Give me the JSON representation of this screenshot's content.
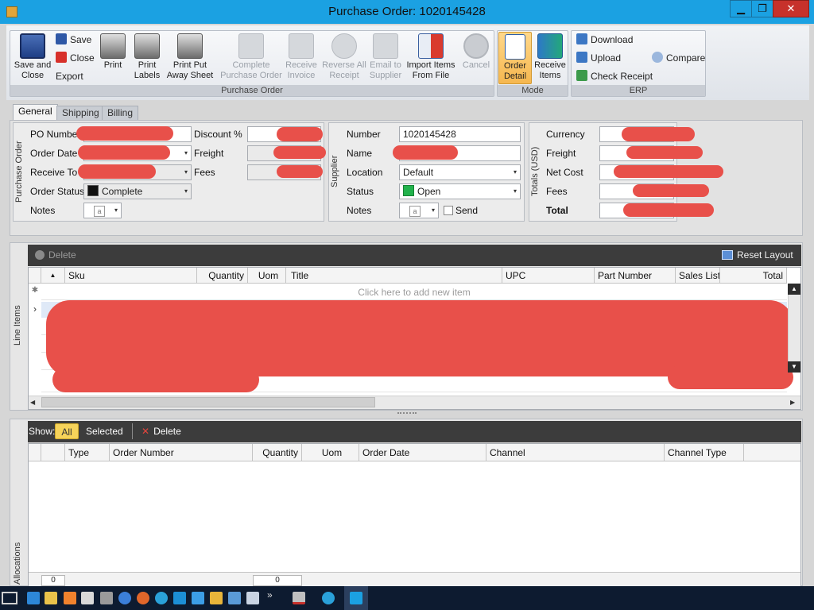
{
  "window": {
    "title": "Purchase Order: 1020145428",
    "min": "▁",
    "max": "❐",
    "close": "✕"
  },
  "ribbon": {
    "save_close": "Save and\nClose",
    "save": "Save",
    "close": "Close",
    "export": "Export",
    "print": "Print",
    "print_labels": "Print\nLabels",
    "print_put_away": "Print Put\nAway Sheet",
    "complete_po": "Complete\nPurchase Order",
    "receive_invoice": "Receive\nInvoice",
    "reverse_all": "Reverse All\nReceipt",
    "email_supplier": "Email to\nSupplier",
    "import_items": "Import Items\nFrom File",
    "cancel": "Cancel",
    "group_po": "Purchase Order",
    "order_detail": "Order\nDetail",
    "receive_items": "Receive\nItems",
    "group_mode": "Mode",
    "download": "Download",
    "upload": "Upload",
    "check_receipt": "Check Receipt",
    "compare": "Compare",
    "group_erp": "ERP"
  },
  "tabs": [
    "General",
    "Shipping",
    "Billing"
  ],
  "po": {
    "caption": "Purchase Order",
    "po_number": "PO Number",
    "order_date": "Order Date",
    "receive_to": "Receive To",
    "order_status": "Order Status",
    "order_status_value": "Complete",
    "notes": "Notes",
    "discount": "Discount %",
    "freight": "Freight",
    "fees": "Fees"
  },
  "supplier": {
    "caption": "Supplier",
    "number": "Number",
    "number_value": "1020145428",
    "name": "Name",
    "location": "Location",
    "location_value": "Default",
    "status": "Status",
    "status_value": "Open",
    "notes": "Notes",
    "send": "Send"
  },
  "totals": {
    "caption": "Totals (USD)",
    "currency": "Currency",
    "freight": "Freight",
    "net_cost": "Net Cost",
    "fees": "Fees",
    "total": "Total"
  },
  "line_items": {
    "caption": "Line Items",
    "delete": "Delete",
    "reset_layout": "Reset Layout",
    "columns": [
      "Sku",
      "Quantity",
      "Uom",
      "Title",
      "UPC",
      "Part Number",
      "Sales Listin",
      "Total"
    ],
    "add_row": "Click here to add new item"
  },
  "allocations": {
    "caption": "Allocations",
    "show": "Show:",
    "all": "All",
    "selected": "Selected",
    "delete": "Delete",
    "columns": [
      "Type",
      "Order Number",
      "Quantity",
      "Uom",
      "Order Date",
      "Channel",
      "Channel Type"
    ],
    "footer_values": [
      "0",
      "0"
    ]
  },
  "icons": {
    "note": "a",
    "glyph_dropdown": "▾"
  },
  "colors": {
    "accent": "#1ba1e2",
    "redaction": "#e8504a",
    "mode_active": "#f6b74f",
    "status_open": "#22b24c"
  }
}
